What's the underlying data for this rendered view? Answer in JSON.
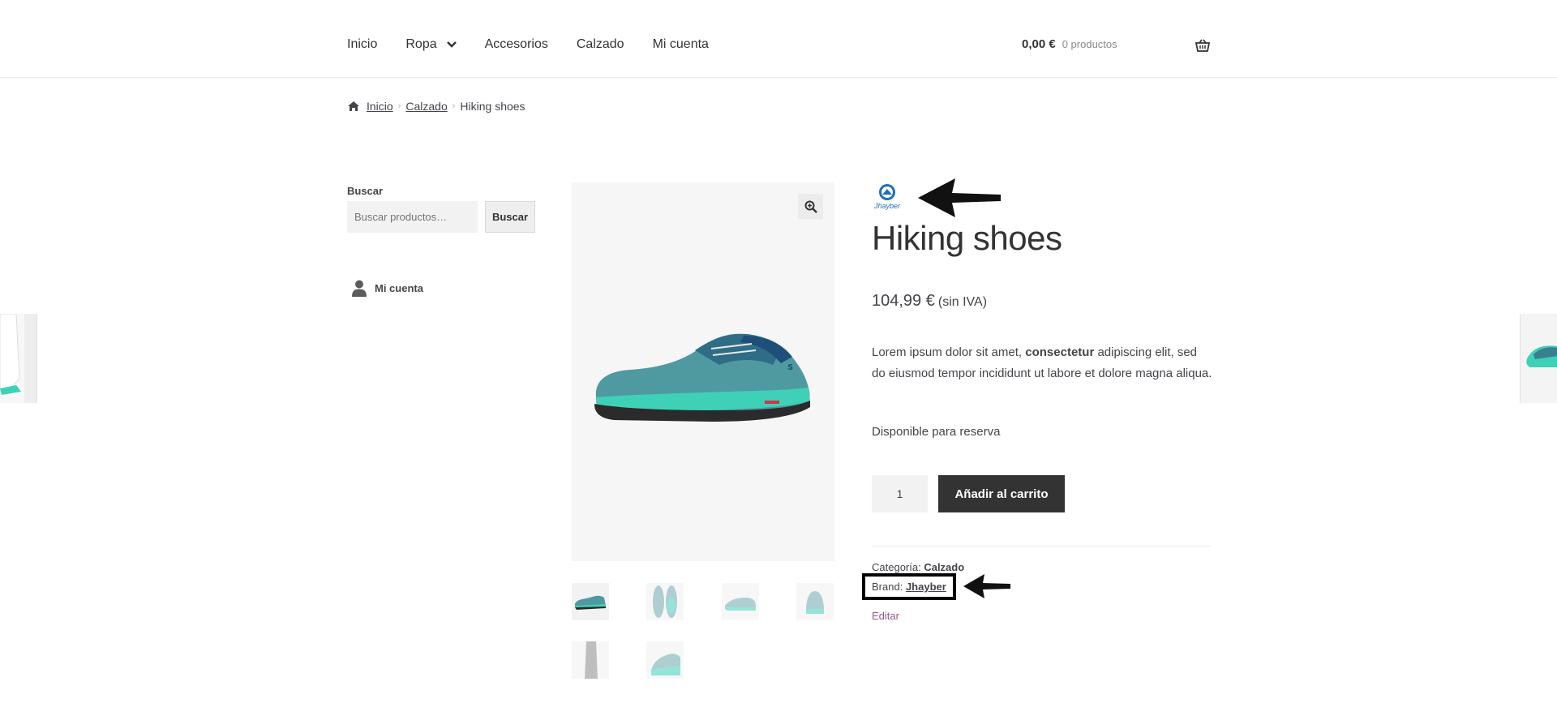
{
  "header": {
    "nav": [
      {
        "label": "Inicio"
      },
      {
        "label": "Ropa",
        "has_dropdown": true
      },
      {
        "label": "Accesorios"
      },
      {
        "label": "Calzado"
      },
      {
        "label": "Mi cuenta"
      }
    ],
    "cart_amount": "0,00 €",
    "cart_count": "0 productos",
    "cart_icon": "basket-icon"
  },
  "breadcrumb": {
    "home_icon": "home-icon",
    "items": [
      "Inicio",
      "Calzado"
    ],
    "current": "Hiking shoes"
  },
  "sidebar": {
    "search_label": "Buscar",
    "search_placeholder": "Buscar productos…",
    "search_button": "Buscar",
    "account_label": "Mi cuenta",
    "account_icon": "user-icon"
  },
  "product": {
    "brand_logo_text": "Jhayber",
    "title": "Hiking shoes",
    "price": "104,99 €",
    "price_suffix": "(sin IVA)",
    "description_start": "Lorem ipsum dolor sit amet, ",
    "description_bold": "consectetur",
    "description_end": " adipiscing elit, sed do eiusmod tempor incididunt ut labore et dolore magna aliqua.",
    "stock": "Disponible para reserva",
    "quantity": "1",
    "add_to_cart": "Añadir al carrito",
    "category_label": "Categoría:",
    "category_value": "Calzado",
    "brand_label": "Brand:",
    "brand_value": "Jhayber",
    "edit_label": "Editar",
    "zoom_icon": "zoom-in-icon"
  },
  "colors": {
    "button_dark": "#333333",
    "shoe_teal": "#3ed1b8",
    "shoe_blue": "#3b7f8f",
    "link_purple": "#96588a",
    "brand_blue": "#1f6fb8"
  }
}
